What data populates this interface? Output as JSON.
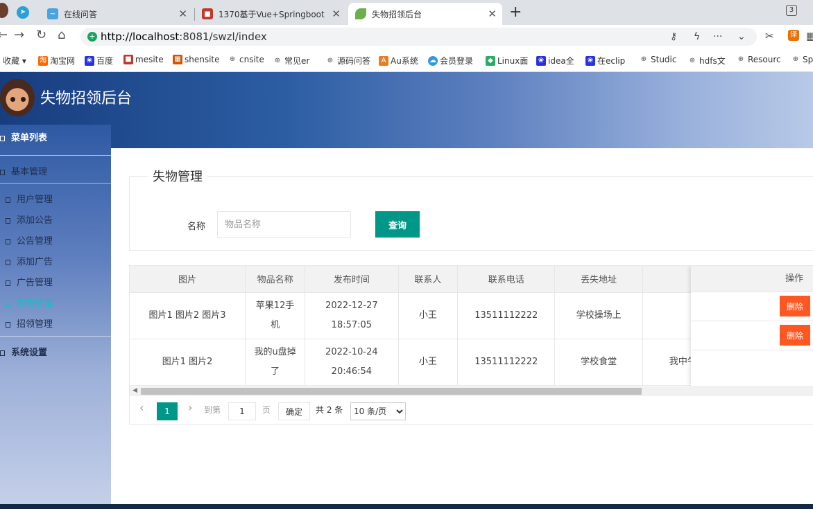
{
  "browser": {
    "tabs": [
      {
        "title": "在线问答",
        "active": false
      },
      {
        "title": "1370基于Vue+Springboot",
        "active": false
      },
      {
        "title": "失物招领后台",
        "active": true
      }
    ],
    "tab_count": "3",
    "url_host": "http://localhost",
    "url_rest": ":8081/swzl/index",
    "bookmarks": [
      "收藏",
      "淘宝网",
      "百度",
      "mesite",
      "shensite",
      "cnsite",
      "常见er",
      "源码问答",
      "Au系统",
      "会员登录",
      "Linux面",
      "idea全",
      "在eclip",
      "Studic",
      "hdfs文",
      "Resourc",
      "Sp"
    ]
  },
  "app": {
    "title": "失物招领后台"
  },
  "sidebar": {
    "menu_title": "菜单列表",
    "groups": [
      {
        "label": "基本管理"
      },
      {
        "label": "系统设置"
      }
    ],
    "items": [
      {
        "label": "用户管理",
        "active": false
      },
      {
        "label": "添加公告",
        "active": false
      },
      {
        "label": "公告管理",
        "active": false
      },
      {
        "label": "添加广告",
        "active": false
      },
      {
        "label": "广告管理",
        "active": false
      },
      {
        "label": "失物管理",
        "active": true
      },
      {
        "label": "招领管理",
        "active": false
      }
    ]
  },
  "main": {
    "section_title": "失物管理",
    "search": {
      "label": "名称",
      "placeholder": "物品名称",
      "value": "",
      "button": "查询"
    },
    "table": {
      "columns": [
        "图片",
        "物品名称",
        "发布时间",
        "联系人",
        "联系电话",
        "丢失地址",
        "",
        "操作"
      ],
      "rows": [
        {
          "images": "图片1 图片2 图片3",
          "name_line1": "苹果12手",
          "name_line2": "机",
          "date": "2022-12-27",
          "time": "18:57:05",
          "contact": "小王",
          "phone": "13511112222",
          "address": "学校操场上",
          "desc": "",
          "action": "删除"
        },
        {
          "images": "图片1 图片2",
          "name_line1": "我的u盘掉",
          "name_line2": "了",
          "date": "2022-10-24",
          "time": "20:46:54",
          "contact": "小王",
          "phone": "13511112222",
          "address": "学校食堂",
          "desc": "我中午吃饭的时",
          "action": "删除"
        }
      ]
    },
    "pager": {
      "prev": "‹",
      "current": "1",
      "next": "›",
      "goto_label": "到第",
      "goto_value": "1",
      "page_unit": "页",
      "confirm": "确定",
      "total": "共 2 条",
      "page_size": "10 条/页"
    }
  },
  "colors": {
    "primary": "#009688",
    "danger": "#ff5722",
    "active_menu": "#0fc0c6"
  }
}
